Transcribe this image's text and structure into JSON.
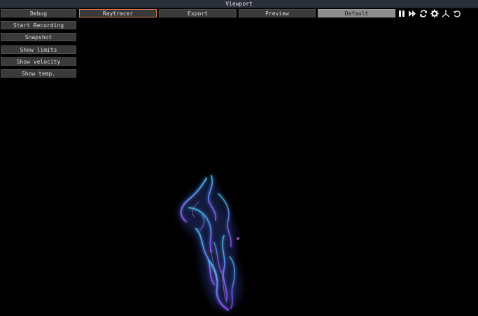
{
  "window": {
    "title": "Viewport"
  },
  "tabs": [
    {
      "label": "Debug"
    },
    {
      "label": "Raytracer"
    },
    {
      "label": "Export"
    },
    {
      "label": "Preview"
    },
    {
      "label": "Default"
    }
  ],
  "side_menu": [
    {
      "label": "Start Recording"
    },
    {
      "label": "Snapshot"
    },
    {
      "label": "Show limits"
    },
    {
      "label": "Show velocity"
    },
    {
      "label": "Show temp."
    }
  ],
  "toolbar_icons": [
    "pause-icon",
    "fast-forward-icon",
    "reload-icon",
    "gear-icon",
    "axes-icon",
    "reset-camera-icon"
  ],
  "colors": {
    "active_tab_border": "#d97a4a",
    "flame_primary": "#3fb8e8",
    "flame_secondary": "#8a4cf0"
  }
}
